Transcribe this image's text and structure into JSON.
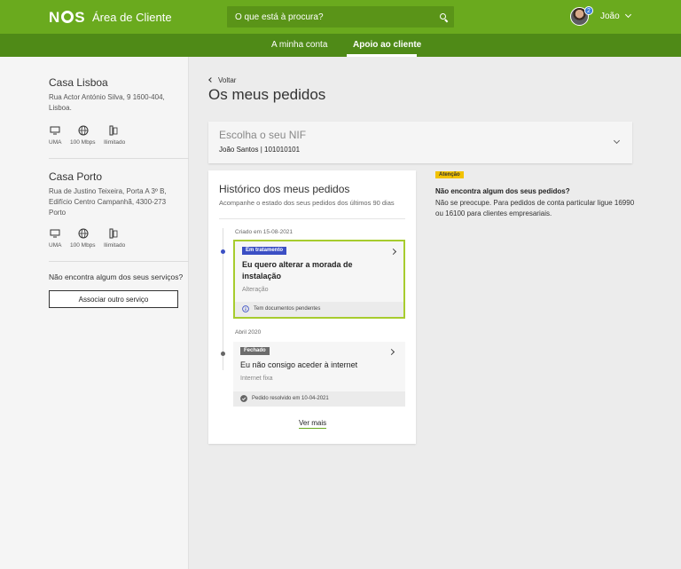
{
  "header": {
    "logo_text": "NOS",
    "app_title": "Área de Cliente",
    "search_placeholder": "O que está à procura?",
    "user_name": "João",
    "notification_count": "2"
  },
  "subnav": {
    "tabs": [
      {
        "label": "A minha conta",
        "active": false
      },
      {
        "label": "Apoio ao cliente",
        "active": true
      }
    ]
  },
  "sidebar": {
    "services": [
      {
        "name": "Casa Lisboa",
        "address": "Rua Actor António Silva, 9 1600-404, Lisboa.",
        "features": [
          "UMA",
          "100 Mbps",
          "Ilimitado"
        ]
      },
      {
        "name": "Casa Porto",
        "address": "Rua de Justino Teixeira, Porta A 3º B, Edifício Centro Campanhã, 4300-273 Porto",
        "features": [
          "UMA",
          "100 Mbps",
          "Ilimitado"
        ]
      }
    ],
    "question": "Não encontra algum dos seus serviços?",
    "associate_button": "Associar outro serviço"
  },
  "main": {
    "back_label": "Voltar",
    "title": "Os meus pedidos",
    "nif": {
      "title": "Escolha o seu NIF",
      "value": "João Santos | 101010101"
    },
    "history": {
      "title": "Histórico dos meus pedidos",
      "subtitle": "Acompanhe o estado dos seus pedidos dos últimos 90 dias",
      "groups": [
        {
          "date": "Criado em 15-08-2021",
          "request": {
            "status": "Em tratamento",
            "status_color": "#3b4fc4",
            "title": "Eu quero alterar a morada de instalação",
            "category": "Alteração",
            "footer": "Tem documentos pendentes"
          }
        },
        {
          "date": "Abril 2020",
          "request": {
            "status": "Fechado",
            "status_color": "#6b6b6b",
            "title": "Eu não consigo aceder à internet",
            "category": "Internet fixa",
            "footer": "Pedido resolvido em 10-04-2021"
          }
        }
      ],
      "more_label": "Ver mais"
    },
    "attention": {
      "badge": "Atenção",
      "title": "Não encontra algum dos seus pedidos?",
      "text": "Não se preocupe. Para pedidos de conta particular ligue 16990 ou 16100 para clientes empresariais."
    }
  },
  "colors": {
    "brand_green": "#6aaa1e",
    "subnav_green": "#4f8a17",
    "highlight": "#a7cc2e",
    "attention_yellow": "#f2c200"
  }
}
